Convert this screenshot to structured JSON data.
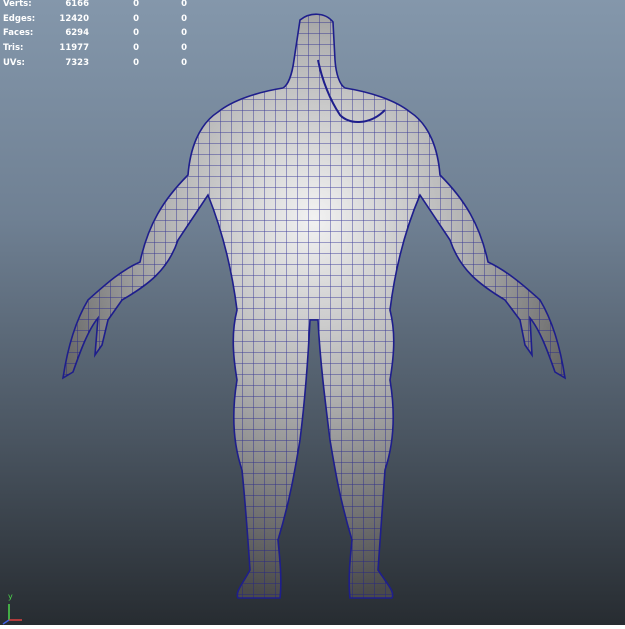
{
  "hud": {
    "rows": [
      {
        "label": "Verts:",
        "v1": "6166",
        "v2": "0",
        "v3": "0"
      },
      {
        "label": "Edges:",
        "v1": "12420",
        "v2": "0",
        "v3": "0"
      },
      {
        "label": "Faces:",
        "v1": "6294",
        "v2": "0",
        "v3": "0"
      },
      {
        "label": "Tris:",
        "v1": "11977",
        "v2": "0",
        "v3": "0"
      },
      {
        "label": "UVs:",
        "v1": "7323",
        "v2": "0",
        "v3": "0"
      }
    ]
  },
  "axis": {
    "y_label": "y"
  },
  "colors": {
    "wire": "#1e1e8c",
    "viewport_top": "#8497ab",
    "viewport_bottom": "#272c31"
  }
}
